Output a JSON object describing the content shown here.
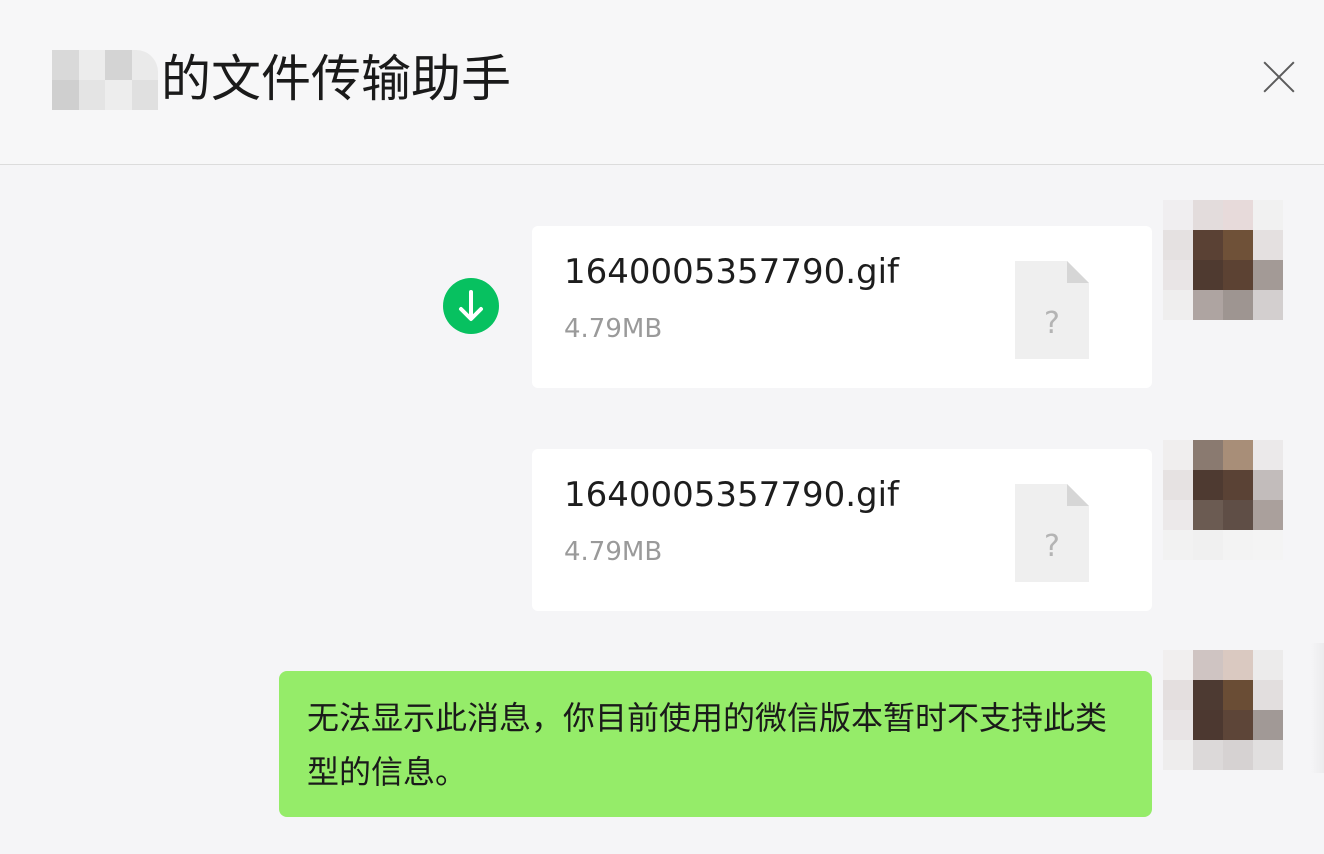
{
  "header": {
    "title": "的文件传输助手"
  },
  "messages": [
    {
      "file_name": "1640005357790.gif",
      "file_size": "4.79MB",
      "file_icon_glyph": "?"
    },
    {
      "file_name": "1640005357790.gif",
      "file_size": "4.79MB",
      "file_icon_glyph": "?"
    }
  ],
  "text_message": "无法显示此消息，你目前使用的微信版本暂时不支持此类型的信息。",
  "colors": {
    "download_green": "#07c160",
    "bubble_green": "#95ec69",
    "background": "#f5f5f7"
  },
  "icons": {
    "close": "close-icon",
    "download": "download-icon",
    "file": "unknown-file-icon"
  }
}
